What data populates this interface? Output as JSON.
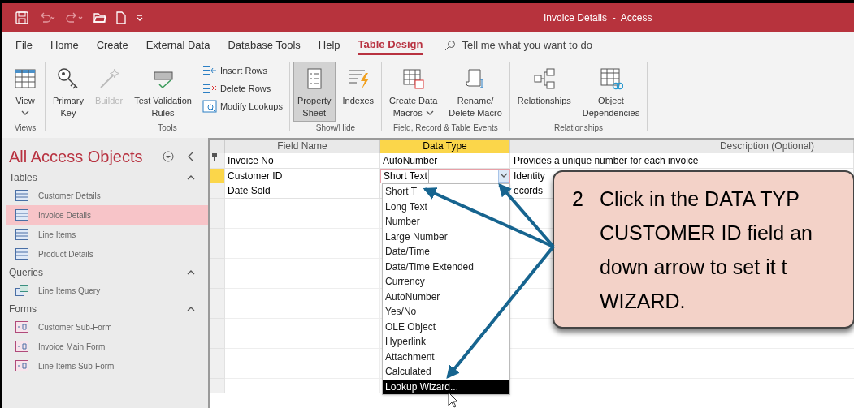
{
  "title_bar": {
    "title": "Invoice Details  -  Access"
  },
  "menu_tabs": [
    {
      "label": "File",
      "selected": false
    },
    {
      "label": "Home",
      "selected": false
    },
    {
      "label": "Create",
      "selected": false
    },
    {
      "label": "External Data",
      "selected": false
    },
    {
      "label": "Database Tools",
      "selected": false
    },
    {
      "label": "Help",
      "selected": false
    },
    {
      "label": "Table Design",
      "selected": true
    }
  ],
  "tell_me": {
    "placeholder": "Tell me what you want to do"
  },
  "ribbon_groups": [
    {
      "label": "Views",
      "buttons": [
        {
          "kind": "large",
          "lines": [
            "View"
          ],
          "dropdown": true,
          "disabled": false,
          "pressed": false
        }
      ]
    },
    {
      "label": "Tools",
      "buttons": [
        {
          "kind": "large",
          "lines": [
            "Primary",
            "Key"
          ],
          "dropdown": false,
          "disabled": false,
          "pressed": false
        },
        {
          "kind": "large",
          "lines": [
            "Builder"
          ],
          "dropdown": false,
          "disabled": true,
          "pressed": false
        },
        {
          "kind": "large",
          "lines": [
            "Test Validation",
            "Rules"
          ],
          "dropdown": false,
          "disabled": false,
          "pressed": false
        },
        {
          "kind": "small",
          "lines": [
            "Insert Rows"
          ],
          "disabled": false,
          "pressed": false
        },
        {
          "kind": "small",
          "lines": [
            "Delete Rows"
          ],
          "disabled": false,
          "pressed": false
        },
        {
          "kind": "small",
          "lines": [
            "Modify Lookups"
          ],
          "disabled": false,
          "pressed": false
        }
      ]
    },
    {
      "label": "Show/Hide",
      "buttons": [
        {
          "kind": "large",
          "lines": [
            "Property",
            "Sheet"
          ],
          "dropdown": false,
          "disabled": false,
          "pressed": true
        },
        {
          "kind": "large",
          "lines": [
            "Indexes"
          ],
          "dropdown": false,
          "disabled": false,
          "pressed": false
        }
      ]
    },
    {
      "label": "Field, Record & Table Events",
      "buttons": [
        {
          "kind": "large",
          "lines": [
            "Create Data",
            "Macros"
          ],
          "dropdown": true,
          "disabled": false,
          "pressed": false
        },
        {
          "kind": "large",
          "lines": [
            "Rename/",
            "Delete Macro"
          ],
          "dropdown": false,
          "disabled": false,
          "pressed": false
        }
      ]
    },
    {
      "label": "Relationships",
      "buttons": [
        {
          "kind": "large",
          "lines": [
            "Relationships"
          ],
          "dropdown": false,
          "disabled": false,
          "pressed": false
        },
        {
          "kind": "large",
          "lines": [
            "Object",
            "Dependencies"
          ],
          "dropdown": false,
          "disabled": false,
          "pressed": false
        }
      ]
    }
  ],
  "navigation_pane": {
    "title": "All Access Objects",
    "sections": [
      {
        "label": "Tables",
        "kind": "table",
        "expanded": true,
        "items": [
          {
            "label": "Customer Details",
            "selected": false
          },
          {
            "label": "Invoice Details",
            "selected": true
          },
          {
            "label": "Line Items",
            "selected": false
          },
          {
            "label": "Product Details",
            "selected": false
          }
        ]
      },
      {
        "label": "Queries",
        "kind": "query",
        "expanded": true,
        "items": [
          {
            "label": "Line Items Query",
            "selected": false
          }
        ]
      },
      {
        "label": "Forms",
        "kind": "form",
        "expanded": true,
        "items": [
          {
            "label": "Customer Sub-Form",
            "selected": false
          },
          {
            "label": "Invoice Main Form",
            "selected": false
          },
          {
            "label": "Line Items Sub-Form",
            "selected": false
          }
        ]
      }
    ]
  },
  "table_design": {
    "columns": [
      {
        "label": "Field Name",
        "selected": false
      },
      {
        "label": "Data Type",
        "selected": true
      },
      {
        "label": "Description (Optional)",
        "selected": false
      }
    ],
    "rows": [
      {
        "field_name": "Invoice No",
        "data_type": "AutoNumber",
        "description": "Provides a unique number for each invoice",
        "primary_key": true,
        "current": false
      },
      {
        "field_name": "Customer ID",
        "data_type": "Short Text",
        "description": "Identity",
        "primary_key": false,
        "current": true
      },
      {
        "field_name": "Date Sold",
        "description": "ecords",
        "primary_key": false,
        "current": false
      }
    ],
    "data_type_dropdown": {
      "options": [
        {
          "label": "Short T",
          "selected": false
        },
        {
          "label": "Long Text",
          "selected": false
        },
        {
          "label": "Number",
          "selected": false
        },
        {
          "label": "Large Number",
          "selected": false
        },
        {
          "label": "Date/Time",
          "selected": false
        },
        {
          "label": "Date/Time Extended",
          "selected": false
        },
        {
          "label": "Currency",
          "selected": false
        },
        {
          "label": "AutoNumber",
          "selected": false
        },
        {
          "label": "Yes/No",
          "selected": false
        },
        {
          "label": "OLE Object",
          "selected": false
        },
        {
          "label": "Hyperlink",
          "selected": false
        },
        {
          "label": "Attachment",
          "selected": false
        },
        {
          "label": "Calculated",
          "selected": false
        },
        {
          "label": "Lookup Wizard...",
          "selected": true
        }
      ]
    }
  },
  "callout": {
    "number": "2",
    "lines": [
      "Click in the DATA TYP",
      "CUSTOMER ID field an",
      "down arrow to set it t",
      "WIZARD."
    ]
  }
}
